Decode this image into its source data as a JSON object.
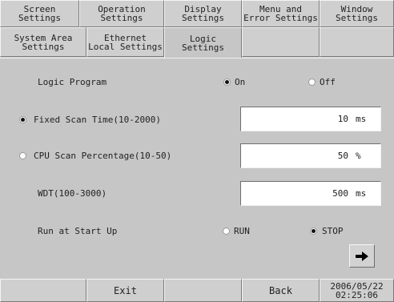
{
  "tabs_row1": [
    {
      "label": "Screen\nSettings"
    },
    {
      "label": "Operation\nSettings"
    },
    {
      "label": "Display\nSettings"
    },
    {
      "label": "Menu and\nError Settings"
    },
    {
      "label": "Window\nSettings"
    }
  ],
  "tabs_row2": [
    {
      "label": "System Area\nSettings"
    },
    {
      "label": "Ethernet\nLocal Settings"
    },
    {
      "label": "Logic\nSettings",
      "active": true
    },
    {
      "label": ""
    },
    {
      "label": ""
    }
  ],
  "logic_program": {
    "label": "Logic Program",
    "options": [
      "On",
      "Off"
    ],
    "selected": "On"
  },
  "fixed_scan": {
    "label": "Fixed Scan Time(10-2000)",
    "value": "10",
    "unit": "ms",
    "selected": true
  },
  "cpu_scan": {
    "label": "CPU Scan Percentage(10-50)",
    "value": "50",
    "unit": "%",
    "selected": false
  },
  "wdt": {
    "label": "WDT(100-3000)",
    "value": "500",
    "unit": "ms"
  },
  "run_at_startup": {
    "label": "Run at Start Up",
    "options": [
      "RUN",
      "STOP"
    ],
    "selected": "STOP"
  },
  "arrow_button_icon": "right-arrow",
  "bottom_bar": {
    "exit_label": "Exit",
    "back_label": "Back",
    "clock": "2006/05/22\n02:25:06"
  }
}
